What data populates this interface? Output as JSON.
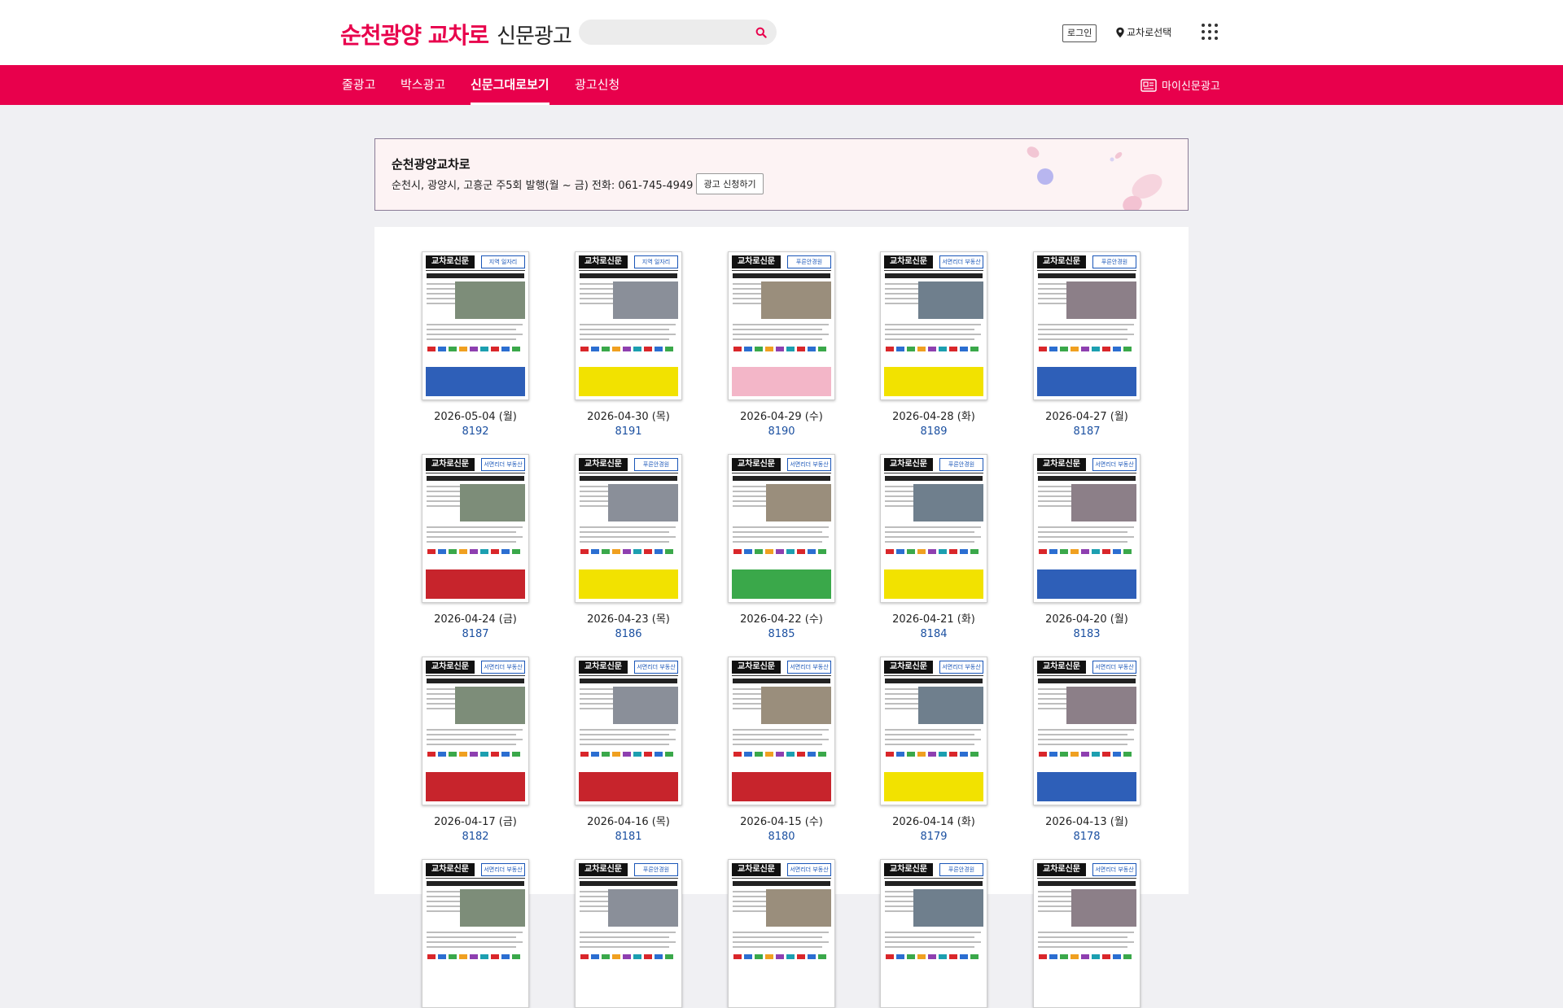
{
  "header": {
    "logo_brand": "순천광양 교차로",
    "logo_sub": "신문광고",
    "search_placeholder": "",
    "login_label": "로그인",
    "region_label": "교차로선택"
  },
  "nav": {
    "items": [
      {
        "label": "줄광고",
        "active": false
      },
      {
        "label": "박스광고",
        "active": false
      },
      {
        "label": "신문그대로보기",
        "active": true
      },
      {
        "label": "광고신청",
        "active": false
      }
    ],
    "my_ads_label": "마이신문광고"
  },
  "info": {
    "title": "순천광양교차로",
    "description": "순천시, 광양시, 고흥군 주5회 발행(월 ~ 금) 전화: 061-745-4949",
    "apply_label": "광고 신청하기"
  },
  "issues": [
    {
      "date": "2026-05-04 (월)",
      "number": "8192",
      "masthead": "교차로신문",
      "tag": "지역 일자리",
      "bottom": "blue"
    },
    {
      "date": "2026-04-30 (목)",
      "number": "8191",
      "masthead": "교차로신문",
      "tag": "지역 일자리",
      "bottom": "yellow"
    },
    {
      "date": "2026-04-29 (수)",
      "number": "8190",
      "masthead": "교차로신문",
      "tag": "푸른안경원",
      "bottom": "pink"
    },
    {
      "date": "2026-04-28 (화)",
      "number": "8189",
      "masthead": "교차로신문",
      "tag": "서면리더 부동산",
      "bottom": "yellow"
    },
    {
      "date": "2026-04-27 (월)",
      "number": "8187",
      "masthead": "교차로신문",
      "tag": "푸른안경원",
      "bottom": "blue"
    },
    {
      "date": "2026-04-24 (금)",
      "number": "8187",
      "masthead": "교차로신문",
      "tag": "서면리더 부동산",
      "bottom": "red"
    },
    {
      "date": "2026-04-23 (목)",
      "number": "8186",
      "masthead": "교차로신문",
      "tag": "푸른안경원",
      "bottom": "yellow"
    },
    {
      "date": "2026-04-22 (수)",
      "number": "8185",
      "masthead": "교차로신문",
      "tag": "서면리더 부동산",
      "bottom": "green"
    },
    {
      "date": "2026-04-21 (화)",
      "number": "8184",
      "masthead": "교차로신문",
      "tag": "푸른안경원",
      "bottom": "yellow"
    },
    {
      "date": "2026-04-20 (월)",
      "number": "8183",
      "masthead": "교차로신문",
      "tag": "서면리더 부동산",
      "bottom": "blue"
    },
    {
      "date": "2026-04-17 (금)",
      "number": "8182",
      "masthead": "교차로신문",
      "tag": "서면리더 부동산",
      "bottom": "red"
    },
    {
      "date": "2026-04-16 (목)",
      "number": "8181",
      "masthead": "교차로신문",
      "tag": "서면리더 부동산",
      "bottom": "red"
    },
    {
      "date": "2026-04-15 (수)",
      "number": "8180",
      "masthead": "교차로신문",
      "tag": "서면리더 부동산",
      "bottom": "red"
    },
    {
      "date": "2026-04-14 (화)",
      "number": "8179",
      "masthead": "교차로신문",
      "tag": "서면리더 부동산",
      "bottom": "yellow"
    },
    {
      "date": "2026-04-13 (월)",
      "number": "8178",
      "masthead": "교차로신문",
      "tag": "서면리더 부동산",
      "bottom": "blue"
    },
    {
      "date": "",
      "number": "",
      "masthead": "교차로신문",
      "tag": "서면리더 부동산",
      "bottom": "none"
    },
    {
      "date": "",
      "number": "",
      "masthead": "교차로신문",
      "tag": "푸른안경원",
      "bottom": "none"
    },
    {
      "date": "",
      "number": "",
      "masthead": "교차로신문",
      "tag": "서면리더 부동산",
      "bottom": "none"
    },
    {
      "date": "",
      "number": "",
      "masthead": "교차로신문",
      "tag": "푸른안경원",
      "bottom": "none"
    },
    {
      "date": "",
      "number": "",
      "masthead": "교차로신문",
      "tag": "서면리더 부동산",
      "bottom": "none"
    }
  ],
  "colors": {
    "accent": "#e8004c",
    "issue_number": "#1a4fa0",
    "bottom_blue": "#2e5fb8",
    "bottom_yellow": "#f2e200",
    "bottom_pink": "#f3b6c8",
    "bottom_red": "#c7242c",
    "bottom_green": "#3aa84a"
  }
}
